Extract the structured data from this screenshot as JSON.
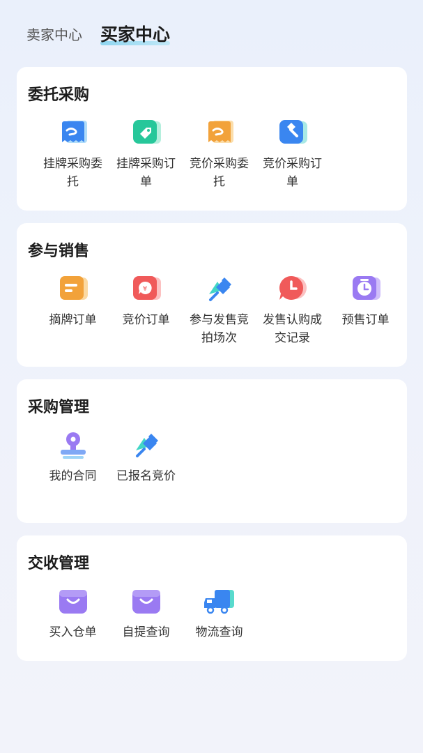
{
  "tabs": {
    "seller": "卖家中心",
    "buyer": "买家中心"
  },
  "sections": [
    {
      "title": "委托采购",
      "items": [
        {
          "label": "挂牌采购委托",
          "icon": "blue-ticket-icon"
        },
        {
          "label": "挂牌采购订单",
          "icon": "green-tag-icon"
        },
        {
          "label": "竞价采购委托",
          "icon": "orange-ticket-icon"
        },
        {
          "label": "竞价采购订单",
          "icon": "gavel-icon"
        }
      ]
    },
    {
      "title": "参与销售",
      "items": [
        {
          "label": "摘牌订单",
          "icon": "document-icon"
        },
        {
          "label": "竞价订单",
          "icon": "yuan-chat-icon"
        },
        {
          "label": "参与发售竞拍场次",
          "icon": "pushpin-icon"
        },
        {
          "label": "发售认购成交记录",
          "icon": "clock-chat-icon"
        },
        {
          "label": "预售订单",
          "icon": "alarm-clock-icon"
        }
      ]
    },
    {
      "title": "采购管理",
      "items": [
        {
          "label": "我的合同",
          "icon": "stamp-icon"
        },
        {
          "label": "已报名竞价",
          "icon": "pushpin-icon"
        }
      ]
    },
    {
      "title": "交收管理",
      "items": [
        {
          "label": "买入仓单",
          "icon": "shopping-bag-icon"
        },
        {
          "label": "自提查询",
          "icon": "shopping-bag-icon"
        },
        {
          "label": "物流查询",
          "icon": "truck-icon"
        }
      ]
    }
  ],
  "colors": {
    "blue": "#3a86f0",
    "green": "#27c79a",
    "orange": "#f2a23a",
    "red": "#f05a5a",
    "purple": "#9a7af2"
  }
}
